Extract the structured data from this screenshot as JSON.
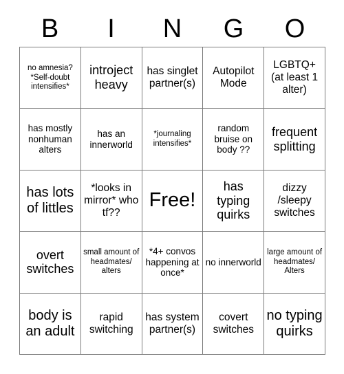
{
  "card": {
    "header_letters": [
      "B",
      "I",
      "N",
      "G",
      "O"
    ],
    "rows": [
      [
        {
          "text": "no amnesia? *Self-doubt intensifies*",
          "size": "xxs"
        },
        {
          "text": "introject heavy",
          "size": "md"
        },
        {
          "text": "has singlet partner(s)",
          "size": "sm"
        },
        {
          "text": "Autopilot Mode",
          "size": "sm"
        },
        {
          "text": "LGBTQ+ (at least 1 alter)",
          "size": "sm"
        }
      ],
      [
        {
          "text": "has mostly nonhuman alters",
          "size": "xs"
        },
        {
          "text": "has an innerworld",
          "size": "xs"
        },
        {
          "text": "*journaling intensifies*",
          "size": "xxs"
        },
        {
          "text": "random bruise on body ??",
          "size": "xs"
        },
        {
          "text": "frequent splitting",
          "size": "md"
        }
      ],
      [
        {
          "text": "has lots of littles",
          "size": "lg"
        },
        {
          "text": "*looks in mirror* who tf??",
          "size": "sm"
        },
        {
          "text": "Free!",
          "size": "xl"
        },
        {
          "text": "has typing quirks",
          "size": "md"
        },
        {
          "text": "dizzy /sleepy switches",
          "size": "sm"
        }
      ],
      [
        {
          "text": "overt switches",
          "size": "md"
        },
        {
          "text": "small amount of headmates/ alters",
          "size": "xxs"
        },
        {
          "text": "*4+ convos happening at once*",
          "size": "xs"
        },
        {
          "text": "no innerworld",
          "size": "xs"
        },
        {
          "text": "large amount of headmates/ Alters",
          "size": "xxs"
        }
      ],
      [
        {
          "text": "body is an adult",
          "size": "lg"
        },
        {
          "text": "rapid switching",
          "size": "sm"
        },
        {
          "text": "has system partner(s)",
          "size": "sm"
        },
        {
          "text": "covert switches",
          "size": "sm"
        },
        {
          "text": "no typing quirks",
          "size": "lg"
        }
      ]
    ]
  },
  "colors": {
    "background": "#ffffff",
    "text": "#000000",
    "grid_border": "#7a7a7a"
  }
}
